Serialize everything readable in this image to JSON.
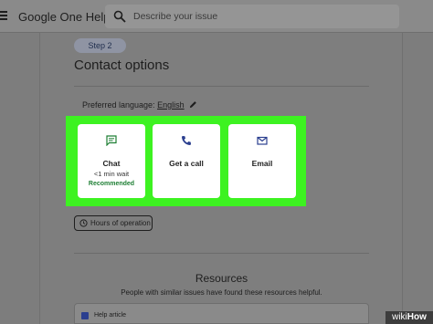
{
  "header": {
    "app_title": "Google One Help",
    "search_placeholder": "Describe your issue"
  },
  "main": {
    "step_label": "Step 2",
    "title": "Contact options",
    "language_label": "Preferred language:",
    "language_value": "English",
    "options": [
      {
        "label": "Chat",
        "detail": "<1 min wait",
        "tag": "Recommended",
        "icon": "chat-bubble-icon"
      },
      {
        "label": "Get a call",
        "icon": "phone-icon"
      },
      {
        "label": "Email",
        "icon": "envelope-icon"
      }
    ],
    "hours_button": "Hours of operation"
  },
  "resources": {
    "title": "Resources",
    "subtitle": "People with similar issues have found these resources helpful.",
    "first_item_label": "Help article"
  },
  "watermark": {
    "part1": "wiki",
    "part2": "How"
  },
  "colors": {
    "highlight": "#3df221",
    "icon_accent": "#2b3f8f",
    "recommended": "#1e7f34"
  }
}
